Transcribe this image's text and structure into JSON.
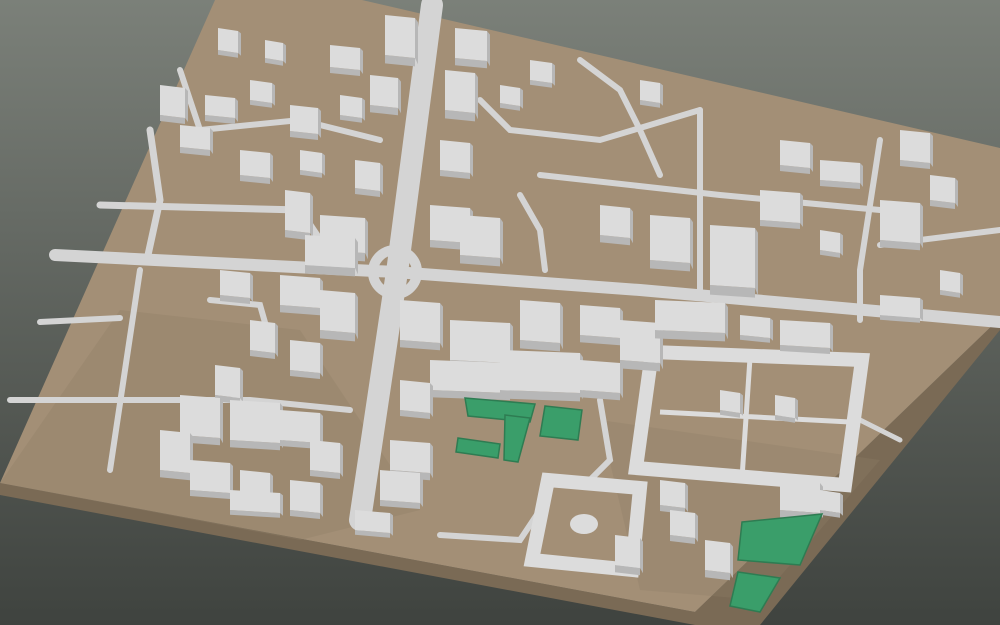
{
  "scene": {
    "background_top": "#7b8079",
    "background_bottom": "#3f433f",
    "terrain_color": "#a38f76",
    "terrain_shadow": "#8f7d66",
    "base_side_color": "#7a6a55",
    "road_color": "#d4d4d4",
    "building_top": "#dcdcdc",
    "building_side": "#b7b7b7",
    "vegetation_color": "#3a9e6a",
    "vegetation_side": "#2e7c52"
  }
}
